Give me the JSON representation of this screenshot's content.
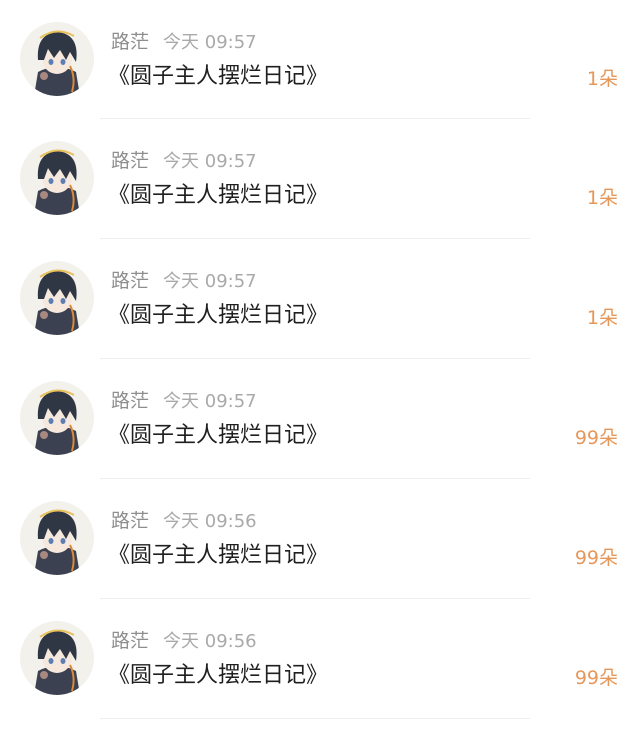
{
  "records": [
    {
      "user": "路茫",
      "time": "今天 09:57",
      "gift": "《圆子主人摆烂日记》",
      "count": "1朵"
    },
    {
      "user": "路茫",
      "time": "今天 09:57",
      "gift": "《圆子主人摆烂日记》",
      "count": "1朵"
    },
    {
      "user": "路茫",
      "time": "今天 09:57",
      "gift": "《圆子主人摆烂日记》",
      "count": "1朵"
    },
    {
      "user": "路茫",
      "time": "今天 09:57",
      "gift": "《圆子主人摆烂日记》",
      "count": "99朵"
    },
    {
      "user": "路茫",
      "time": "今天 09:56",
      "gift": "《圆子主人摆烂日记》",
      "count": "99朵"
    },
    {
      "user": "路茫",
      "time": "今天 09:56",
      "gift": "《圆子主人摆烂日记》",
      "count": "99朵"
    }
  ],
  "colors": {
    "count": "#e6975a",
    "username": "#8e8e8e",
    "time": "#a9a9a9",
    "title": "#1f1f1f"
  }
}
